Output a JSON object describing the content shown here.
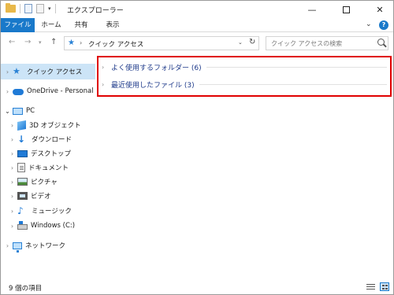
{
  "window": {
    "title": "エクスプローラー"
  },
  "ribbon": {
    "tabs": [
      {
        "label": "ファイル"
      },
      {
        "label": "ホーム"
      },
      {
        "label": "共有"
      },
      {
        "label": "表示"
      }
    ],
    "accent_color": "#1979ca"
  },
  "address": {
    "location": "クイック アクセス",
    "search_placeholder": "クイック アクセスの検索"
  },
  "navigation": {
    "items": [
      {
        "label": "クイック アクセス",
        "icon": "star-icon",
        "selected": true
      },
      {
        "label": "OneDrive - Personal",
        "icon": "cloud-icon"
      },
      {
        "label": "PC",
        "icon": "computer-icon",
        "expanded": true
      },
      {
        "label": "3D オブジェクト",
        "icon": "3d-objects-icon"
      },
      {
        "label": "ダウンロード",
        "icon": "download-icon"
      },
      {
        "label": "デスクトップ",
        "icon": "desktop-icon"
      },
      {
        "label": "ドキュメント",
        "icon": "document-icon"
      },
      {
        "label": "ピクチャ",
        "icon": "picture-icon"
      },
      {
        "label": "ビデオ",
        "icon": "video-icon"
      },
      {
        "label": "ミュージック",
        "icon": "music-icon"
      },
      {
        "label": "Windows (C:)",
        "icon": "drive-icon"
      },
      {
        "label": "ネットワーク",
        "icon": "network-icon"
      }
    ]
  },
  "content": {
    "groups": [
      {
        "label": "よく使用するフォルダー (6)"
      },
      {
        "label": "最近使用したファイル (3)"
      }
    ],
    "highlight_color": "#e00000"
  },
  "status": {
    "text": "9 個の項目"
  }
}
